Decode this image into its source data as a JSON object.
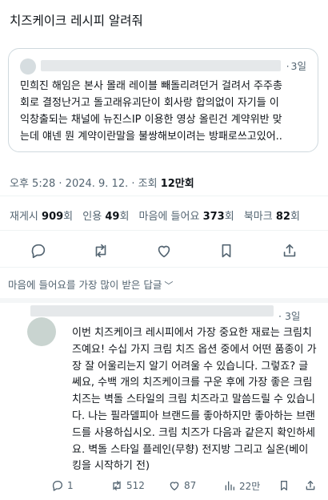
{
  "post": {
    "title": "치즈케이크 레시피 알려줘"
  },
  "quoted": {
    "time": "3일",
    "lines": [
      "민희진 해임은 본사 몰래 레이블 빼돌리려던거 걸려서 주주총",
      "회로 결정난거고 돌고래유괴단이 회사랑 합의없이 자기들 이",
      "익창출되는 채널에 뉴진스IP 이용한 영상 올린건 계약위반 맞",
      "는데 얘넨 뭔 계약이란말을 불쌍해보이려는 방패로쓰고있어.."
    ]
  },
  "meta": {
    "time": "오후 5:28",
    "date": "2024. 9. 12.",
    "views_label": "조회",
    "views_value": "12만회",
    "sep": "·"
  },
  "stats": {
    "reposts_label": "재게시",
    "reposts_value": "909",
    "quotes_label": "인용",
    "quotes_value": "49",
    "likes_label": "마음에 들어요",
    "likes_value": "373",
    "bookmarks_label": "북마크",
    "bookmarks_value": "82",
    "unit": "회"
  },
  "sort": {
    "label": "마음에 들어요를 가장 많이 받은 답글"
  },
  "reply": {
    "time": "3일",
    "lines": [
      "이번 치즈케이크 레시피에서 가장 중요한 재료는 크림치",
      "즈예요! 수십 가지 크림 치즈 옵션 중에서 어떤 품종이 가",
      "장 잘 어울리는지 알기 어려울 수 있습니다. 그렇죠? 글",
      "쎄요, 수백 개의 치즈케이크를 구운 후에 가장 좋은 크림",
      "치즈는 벽돌 스타일의 크림 치즈라고 말씀드릴 수 있습니",
      "다. 나는 필라델피아 브랜드를 좋아하지만 좋아하는 브랜",
      "드를 사용하십시오. 크림 치즈가 다음과 같은지 확인하세",
      "요. 벽돌 스타일 플레인(무향) 전지방 그리고 실온(베이",
      "킹을 시작하기 전)"
    ],
    "replies": "1",
    "reposts": "512",
    "likes": "87",
    "views": "22만"
  },
  "colors": {
    "text": "#0f1419",
    "muted": "#536471",
    "border": "#cfd9de"
  },
  "icons": [
    "reply-icon",
    "repost-icon",
    "like-icon",
    "bookmark-icon",
    "share-icon",
    "views-icon",
    "chevron-down-icon"
  ]
}
